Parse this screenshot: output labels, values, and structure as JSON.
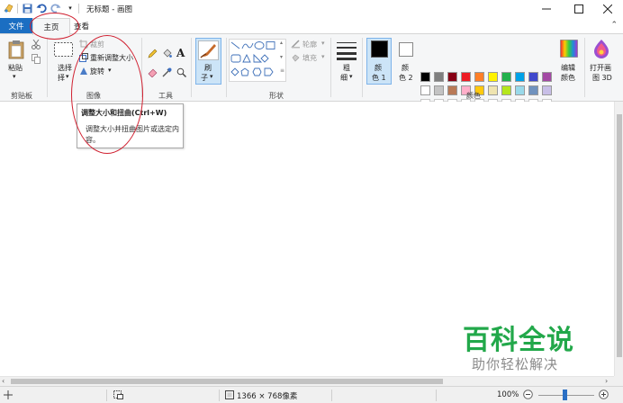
{
  "title_bar": {
    "title": "无标题 - 画图",
    "quick_access": [
      "paint-app-icon",
      "save-icon",
      "undo-icon",
      "redo-icon",
      "customize-dropdown-icon"
    ]
  },
  "tabs": {
    "file": "文件",
    "home": "主页",
    "view": "查看"
  },
  "ribbon": {
    "clipboard": {
      "paste": "粘贴",
      "group": "剪贴板"
    },
    "image": {
      "select": "选择",
      "crop": "裁剪",
      "resize": "重新调整大小",
      "rotate": "旋转",
      "group": "图像"
    },
    "tools": {
      "group": "工具",
      "text_glyph": "A"
    },
    "brushes": {
      "label_line1": "刷",
      "label_line2": "子"
    },
    "shapes": {
      "outline": "轮廓",
      "fill": "填充",
      "group": "形状"
    },
    "size": {
      "label_line1": "粗",
      "label_line2": "细"
    },
    "colors": {
      "color1_line1": "颜",
      "color1_line2": "色 1",
      "color2_line1": "颜",
      "color2_line2": "色 2",
      "edit_line1": "编辑",
      "edit_line2": "颜色",
      "group": "颜色",
      "color1_value": "#000000",
      "color2_value": "#ffffff",
      "palette_row1": [
        "#000000",
        "#7f7f7f",
        "#880015",
        "#ed1c24",
        "#ff7f27",
        "#fff200",
        "#22b14c",
        "#00a2e8",
        "#3f48cc",
        "#a349a4"
      ],
      "palette_row2": [
        "#ffffff",
        "#c3c3c3",
        "#b97a57",
        "#ffaec9",
        "#ffc90e",
        "#efe4b0",
        "#b5e61d",
        "#99d9ea",
        "#7092be",
        "#c8bfe7"
      ]
    },
    "paint3d": {
      "line1": "打开画",
      "line2": "图 3D"
    }
  },
  "tooltip": {
    "title": "调整大小和扭曲(Ctrl+W)",
    "description": "调整大小并扭曲图片或选定内容。"
  },
  "status_bar": {
    "image_size": "1366 × 768像素",
    "zoom": "100%"
  },
  "watermark": {
    "title": "百科全说",
    "subtitle": "助你轻松解决"
  },
  "colors": {
    "accent": "#1b6ec2",
    "annotation": "#d02030",
    "watermark": "#22a84a"
  }
}
